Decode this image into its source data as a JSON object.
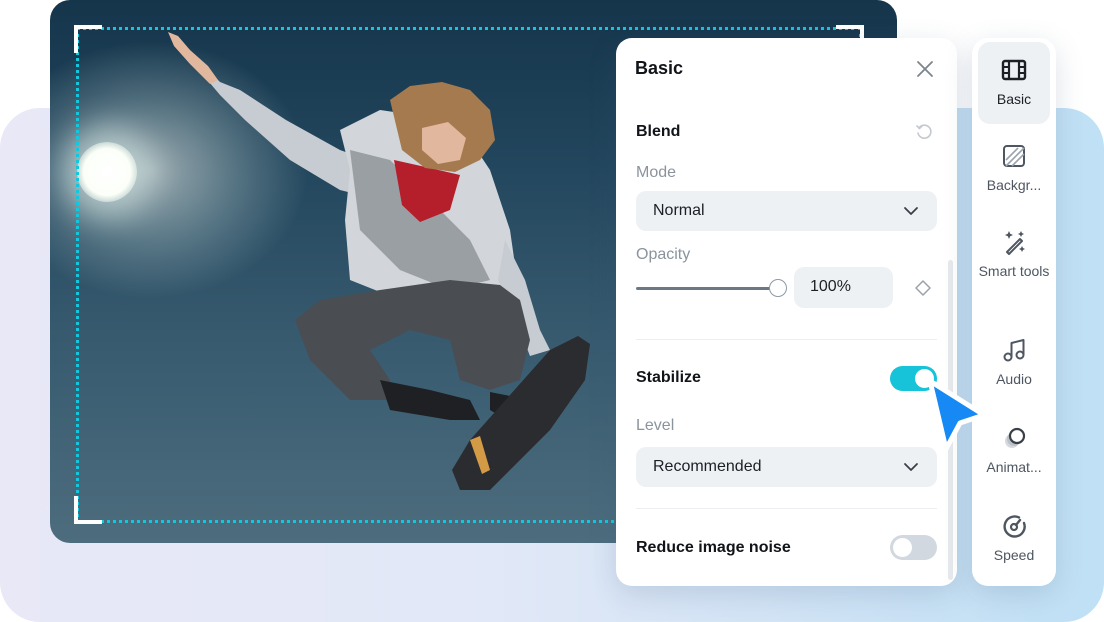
{
  "canvas": {
    "selection_color": "#13c7dd"
  },
  "panel": {
    "title": "Basic",
    "close_icon": "close-icon",
    "blend": {
      "title": "Blend",
      "reset_icon": "reset-icon",
      "mode_label": "Mode",
      "mode_value": "Normal",
      "opacity_label": "Opacity",
      "opacity_value": "100%",
      "opacity_fraction": 1.0,
      "keyframe_icon": "diamond-keyframe-icon"
    },
    "stabilize": {
      "title": "Stabilize",
      "enabled": true,
      "level_label": "Level",
      "level_value": "Recommended"
    },
    "noise": {
      "title": "Reduce image noise",
      "enabled": false
    },
    "accent_color": "#17c3d8"
  },
  "toolbar": {
    "items": [
      {
        "label": "Basic",
        "icon": "film-icon",
        "active": true
      },
      {
        "label": "Backgr...",
        "icon": "background-icon",
        "active": false
      },
      {
        "label": "Smart tools",
        "icon": "magic-wand-icon",
        "active": false
      },
      {
        "label": "Audio",
        "icon": "music-note-icon",
        "active": false
      },
      {
        "label": "Animat...",
        "icon": "animation-icon",
        "active": false
      },
      {
        "label": "Speed",
        "icon": "speedometer-icon",
        "active": false
      }
    ]
  },
  "cursor": {
    "icon": "pointer-cursor-icon",
    "color": "#1689f5"
  }
}
